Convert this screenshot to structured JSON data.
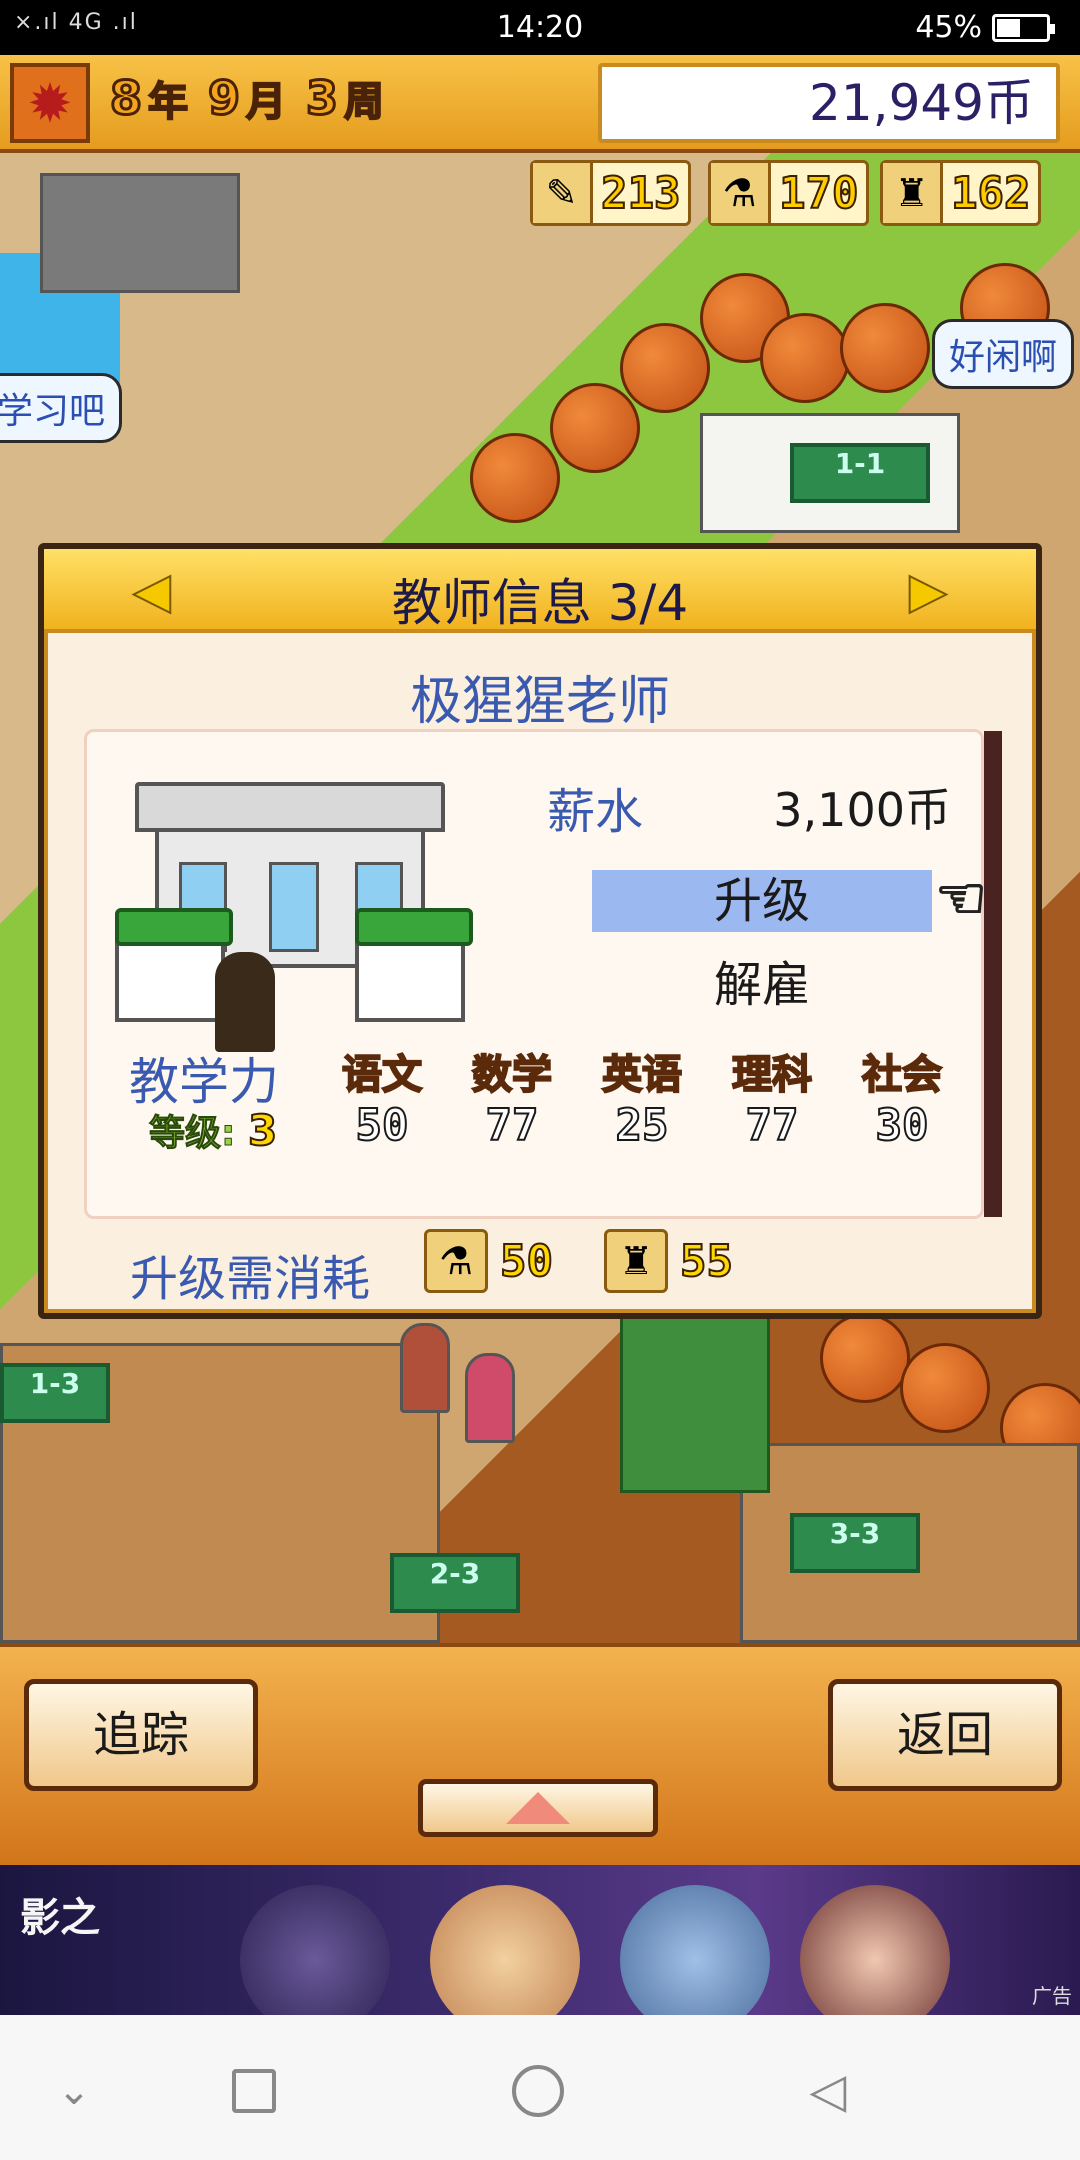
{
  "status_bar": {
    "signal": "×.ıl 4G .ıl",
    "time": "14:20",
    "battery": "45%"
  },
  "top_bar": {
    "year": "8",
    "year_unit": "年",
    "month": "9",
    "month_unit": "月",
    "week": "3",
    "week_unit": "周",
    "money": "21,949币"
  },
  "resources": [
    {
      "icon": "pencil-icon",
      "value": "213"
    },
    {
      "icon": "flask-icon",
      "value": "170"
    },
    {
      "icon": "bell-icon",
      "value": "162"
    }
  ],
  "map": {
    "bubble_left": "学习吧",
    "bubble_right": "好闲啊",
    "boards": [
      "1-1",
      "1-3",
      "2-3",
      "3-3"
    ]
  },
  "dialog": {
    "title": "教师信息 3/4",
    "prev_label": "◀",
    "next_label": "▶",
    "teacher_name": "极猩猩老师",
    "salary_label": "薪水",
    "salary_value": "3,100币",
    "upgrade_label": "升级",
    "fire_label": "解雇",
    "teaching_label": "教学力",
    "level_label": "等级:",
    "level_value": "3",
    "subjects": [
      {
        "name": "语文",
        "value": "50"
      },
      {
        "name": "数学",
        "value": "77"
      },
      {
        "name": "英语",
        "value": "25"
      },
      {
        "name": "理科",
        "value": "77"
      },
      {
        "name": "社会",
        "value": "30"
      }
    ],
    "cost_label": "升级需消耗",
    "costs": [
      {
        "icon": "flask-icon",
        "value": "50"
      },
      {
        "icon": "bell-icon",
        "value": "55"
      }
    ]
  },
  "bottom_bar": {
    "track_label": "追踪",
    "back_label": "返回"
  },
  "ad": {
    "logo": "影之",
    "mark": "广告"
  }
}
